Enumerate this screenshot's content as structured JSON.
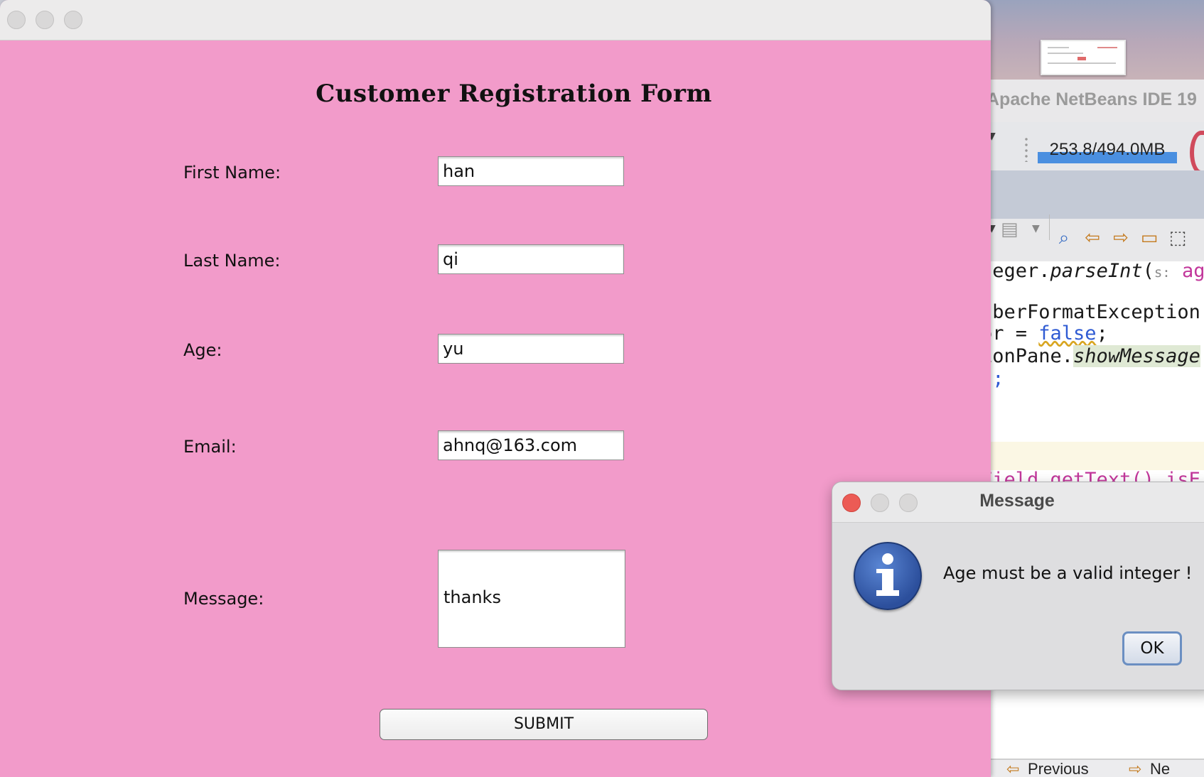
{
  "ide": {
    "title": "Apache NetBeans IDE 19",
    "memory": "253.8/494.0MB",
    "code_lines": [
      {
        "a": "teger.",
        "b": "parseInt",
        "c": "(",
        "d": "s:",
        "e": " ag"
      },
      {
        "a": "nberFormatException"
      },
      {
        "a": "or = ",
        "b": "false",
        "c": ";"
      },
      {
        "a": "ionPane.",
        "b": "showMessage"
      },
      {
        "a": "n;"
      },
      {
        "a": "Field.getText().isE"
      }
    ],
    "bottom_prev": "Previous",
    "bottom_next": "Ne"
  },
  "form": {
    "title": "Customer Registration Form",
    "fields": {
      "first_name": {
        "label": "First Name:",
        "value": "han"
      },
      "last_name": {
        "label": "Last Name:",
        "value": "qi"
      },
      "age": {
        "label": "Age:",
        "value": "yu"
      },
      "email": {
        "label": "Email:",
        "value": "ahnq@163.com"
      },
      "message": {
        "label": "Message:",
        "value": "thanks"
      }
    },
    "submit_label": "SUBMIT"
  },
  "dialog": {
    "title": "Message",
    "text": "Age must be a valid integer !",
    "ok_label": "OK"
  },
  "colors": {
    "form_background": "#f29bca",
    "close_button": "#ec5b55",
    "info_icon": "#2c4f9c",
    "memory_bar": "#4a8fe0"
  }
}
